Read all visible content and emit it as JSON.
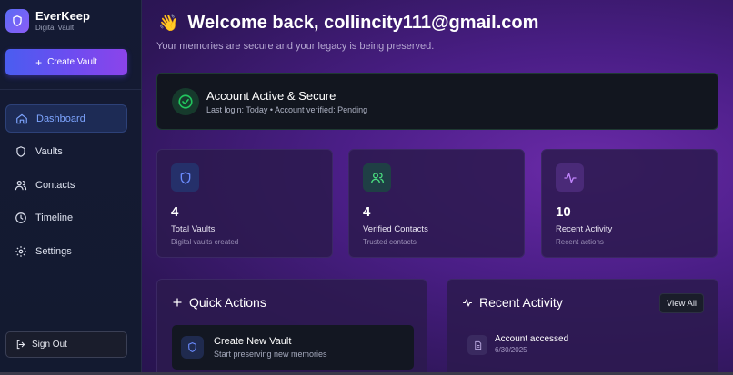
{
  "brand": {
    "name": "EverKeep",
    "tagline": "Digital Vault",
    "logo_icon": "shield-icon"
  },
  "sidebar": {
    "create_label": "Create Vault",
    "items": [
      {
        "label": "Dashboard",
        "icon": "home-icon",
        "active": true
      },
      {
        "label": "Vaults",
        "icon": "shield-icon",
        "active": false
      },
      {
        "label": "Contacts",
        "icon": "users-icon",
        "active": false
      },
      {
        "label": "Timeline",
        "icon": "clock-icon",
        "active": false
      },
      {
        "label": "Settings",
        "icon": "gear-icon",
        "active": false
      }
    ],
    "signout_label": "Sign Out"
  },
  "header": {
    "emoji": "👋",
    "title": "Welcome back, collincity111@gmail.com",
    "subtitle": "Your memories are secure and your legacy is being preserved."
  },
  "status": {
    "title": "Account Active & Secure",
    "subtitle": "Last login: Today • Account verified: Pending"
  },
  "stats": [
    {
      "value": "4",
      "label": "Total Vaults",
      "sub": "Digital vaults created",
      "icon": "shield-icon",
      "color": "#6b8cff"
    },
    {
      "value": "4",
      "label": "Verified Contacts",
      "sub": "Trusted contacts",
      "icon": "users-icon",
      "color": "#4ade80"
    },
    {
      "value": "10",
      "label": "Recent Activity",
      "sub": "Recent actions",
      "icon": "activity-icon",
      "color": "#c084fc"
    }
  ],
  "quick_actions": {
    "title": "Quick Actions",
    "items": [
      {
        "title": "Create New Vault",
        "sub": "Start preserving new memories",
        "icon": "shield-icon"
      }
    ]
  },
  "recent_activity": {
    "title": "Recent Activity",
    "view_all": "View All",
    "items": [
      {
        "title": "Account accessed",
        "date": "6/30/2025",
        "icon": "document-icon"
      }
    ]
  },
  "colors": {
    "accent": "#6366f1",
    "success": "#22c55e",
    "active_nav": "#7ea5ff"
  }
}
